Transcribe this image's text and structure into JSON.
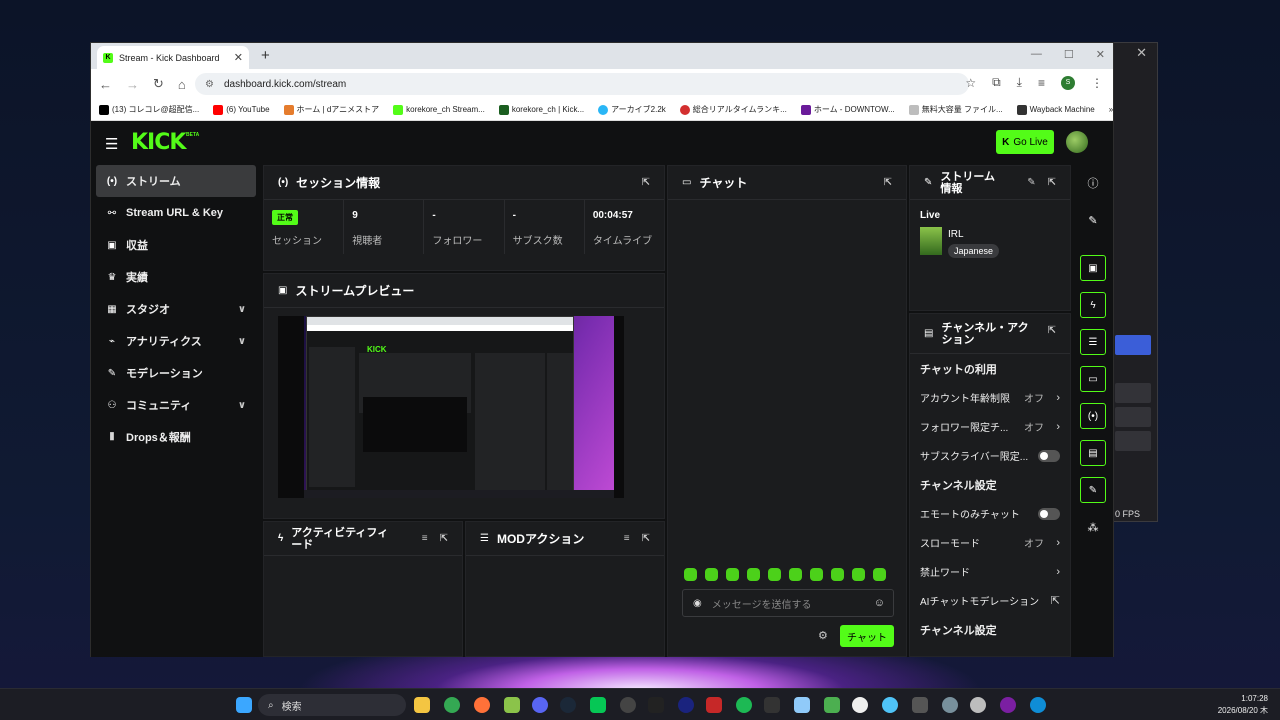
{
  "browser": {
    "tab_title": "Stream - Kick Dashboard",
    "url": "dashboard.kick.com/stream",
    "profile_initial": "S",
    "bookmarks": [
      "(13) コレコレ@超配信...",
      "(6) YouTube",
      "ホーム | dアニメストア",
      "korekore_ch Stream...",
      "korekore_ch | Kick...",
      "アーカイブ2.2k",
      "総合リアルタイムランキ...",
      "ホーム - DOWNTOW...",
      "無料大容量 ファイル...",
      "Wayback Machine"
    ]
  },
  "app": {
    "logo": "KICK",
    "beta": "BETA",
    "go_live": "Go Live"
  },
  "sidebar": {
    "items": [
      {
        "label": "ストリーム",
        "icon": "(•)"
      },
      {
        "label": "Stream URL & Key",
        "icon": "⚯"
      },
      {
        "label": "収益",
        "icon": "▣"
      },
      {
        "label": "実績",
        "icon": "♛"
      },
      {
        "label": "スタジオ",
        "icon": "▦",
        "chev": "∨"
      },
      {
        "label": "アナリティクス",
        "icon": "⌁",
        "chev": "∨"
      },
      {
        "label": "モデレーション",
        "icon": "✎"
      },
      {
        "label": "コミュニティ",
        "icon": "⚇",
        "chev": "∨"
      },
      {
        "label": "Drops＆報酬",
        "icon": "⫴"
      }
    ]
  },
  "session": {
    "title": "セッション情報",
    "stats": [
      {
        "value": "正常",
        "label": "セッション",
        "badge": true
      },
      {
        "value": "9",
        "label": "視聴者"
      },
      {
        "value": "-",
        "label": "フォロワー"
      },
      {
        "value": "-",
        "label": "サブスク数"
      },
      {
        "value": "00:04:57",
        "label": "タイムライブ"
      }
    ]
  },
  "preview": {
    "title": "ストリームプレビュー",
    "mini_logo": "KICK"
  },
  "activity": {
    "title": "アクティビティフィード"
  },
  "mod": {
    "title": "MODアクション"
  },
  "chat": {
    "title": "チャット",
    "placeholder": "メッセージを送信する",
    "send": "チャット"
  },
  "info": {
    "title": "ストリーム情報",
    "live_label": "Live",
    "category": "IRL",
    "language": "Japanese"
  },
  "actions": {
    "title": "チャンネル・アクション",
    "rows": [
      {
        "label": "チャットの利用",
        "type": "heading"
      },
      {
        "label": "アカウント年齢制限",
        "value": "オフ",
        "type": "arrow"
      },
      {
        "label": "フォロワー限定チ...",
        "value": "オフ",
        "type": "arrow"
      },
      {
        "label": "サブスクライバー限定...",
        "type": "toggle"
      },
      {
        "label": "チャンネル設定",
        "type": "heading"
      },
      {
        "label": "エモートのみチャット",
        "type": "toggle"
      },
      {
        "label": "スローモード",
        "value": "オフ",
        "type": "arrow"
      },
      {
        "label": "禁止ワード",
        "type": "arrow"
      },
      {
        "label": "AIチャットモデレーション",
        "type": "ext"
      },
      {
        "label": "チャンネル設定",
        "type": "heading"
      }
    ]
  },
  "obs": {
    "fps": "0 FPS"
  },
  "taskbar": {
    "search": "検索",
    "time": "1:07:28",
    "date": "2026/08/20 木"
  },
  "colors": {
    "accent": "#53fc18",
    "panel": "#1b1c1e",
    "bg": "#101112"
  }
}
